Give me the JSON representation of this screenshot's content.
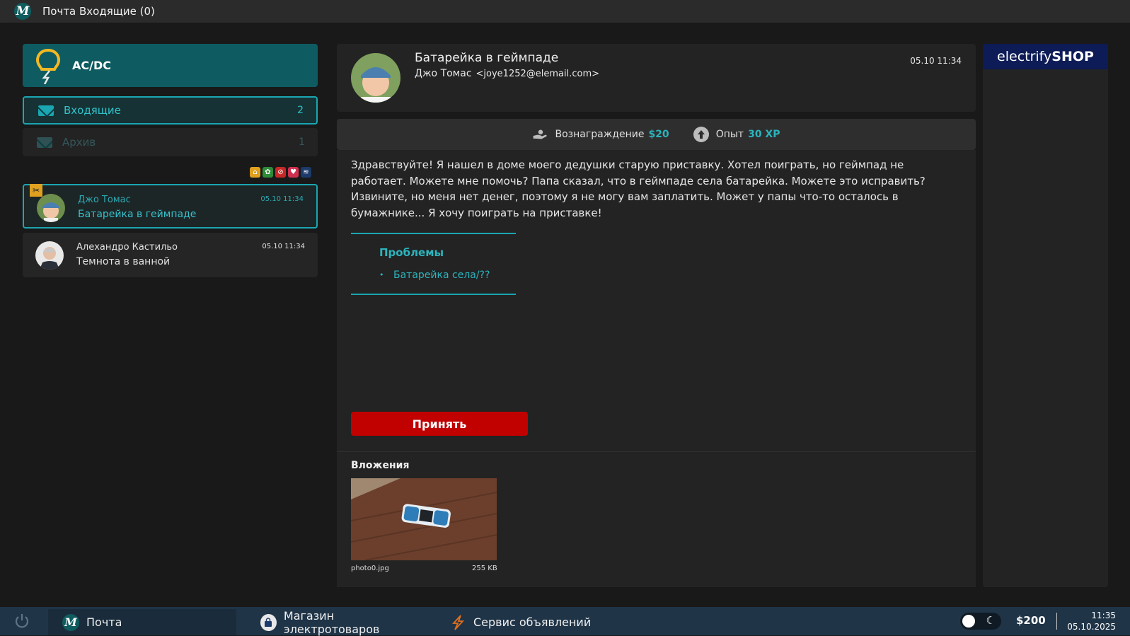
{
  "window": {
    "title": "Почта Входящие (0)",
    "logo_letter": "M"
  },
  "company": {
    "name": "AC/DC"
  },
  "folders": [
    {
      "label": "Входящие",
      "count": "2"
    },
    {
      "label": "Архив",
      "count": "1"
    }
  ],
  "messages": [
    {
      "sender": "Джо Томас",
      "subject": "Батарейка в геймпаде",
      "time": "05.10 11:34"
    },
    {
      "sender": "Алехандро Кастильо",
      "subject": "Темнота в ванной",
      "time": "05.10 11:34"
    }
  ],
  "mail": {
    "subject": "Батарейка в геймпаде",
    "from_name": "Джо Томас",
    "from_email": "<joye1252@elemail.com>",
    "time": "05.10 11:34",
    "reward_label": "Вознаграждение",
    "reward_value": "$20",
    "xp_label": "Опыт",
    "xp_value": "30 XP",
    "body": "Здравствуйте! Я нашел в доме моего дедушки старую приставку. Хотел поиграть, но геймпад не работает. Можете мне помочь? Папа сказал, что в геймпаде села батарейка. Можете это исправить? Извините, но меня нет денег, поэтому я не могу вам заплатить. Может у папы что-то осталось в бумажнике... Я хочу поиграть на приставке!",
    "problems_title": "Проблемы",
    "problems": [
      "Батарейка села/??"
    ],
    "accept_label": "Принять",
    "attachments_title": "Вложения",
    "attachment": {
      "name": "photo0.jpg",
      "size": "255 KB"
    }
  },
  "shop": {
    "brand_light": "electrify",
    "brand_bold": "SHOP"
  },
  "taskbar": {
    "items": [
      {
        "label": "Почта"
      },
      {
        "label": "Магазин электротоваров"
      },
      {
        "label": "Сервис объявлений"
      }
    ],
    "money": "$200",
    "time": "11:35",
    "date": "05.10.2025"
  },
  "colors": {
    "accent": "#1aa6b2",
    "accept": "#c10000",
    "company": "#0e5c61",
    "taskbar": "#1f3447"
  },
  "icons": [
    "app-logo-icon",
    "lightbulb-bolt-icon",
    "envelope-icon",
    "tool-badge-icon",
    "hand-money-icon",
    "arrow-up-icon",
    "power-icon",
    "shopping-bag-icon",
    "lightning-icon",
    "moon-icon"
  ]
}
